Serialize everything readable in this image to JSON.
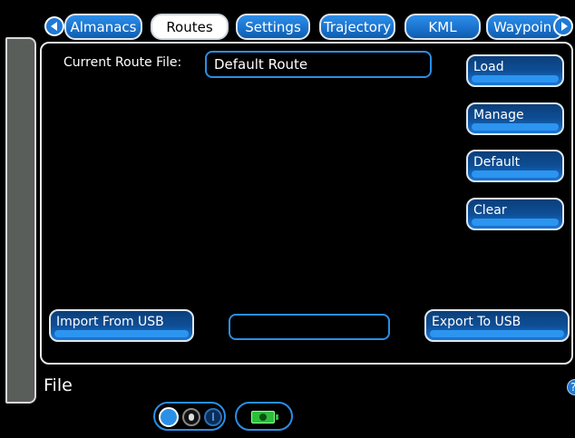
{
  "tabs": [
    {
      "label": "Almanacs",
      "active": false
    },
    {
      "label": "Routes",
      "active": true
    },
    {
      "label": "Settings",
      "active": false
    },
    {
      "label": "Trajectory",
      "active": false
    },
    {
      "label": "KML",
      "active": false
    },
    {
      "label": "Waypoin",
      "active": false
    }
  ],
  "route": {
    "label": "Current Route File:",
    "value": "Default Route"
  },
  "actions": {
    "load": "Load",
    "manage": "Manage",
    "default": "Default",
    "clear": "Clear",
    "import": "Import From USB",
    "export": "Export To USB"
  },
  "midField": "",
  "footer": {
    "title": "File",
    "help": "?"
  },
  "colors": {
    "accent": "#1f7ad6",
    "battery": "#2bbf3a",
    "sidePanel": "#5a5e5a"
  }
}
